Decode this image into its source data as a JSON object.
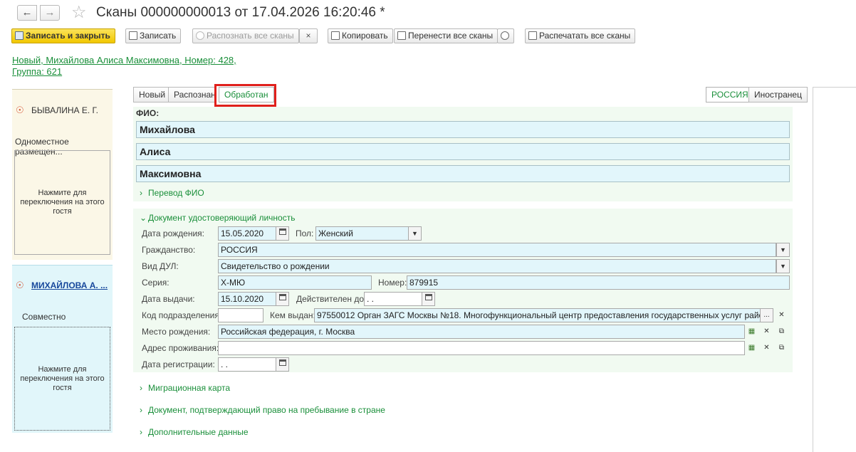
{
  "window": {
    "title": "Сканы 000000000013 от 17.04.2026 16:20:46 *"
  },
  "toolbar": {
    "save_close": "Записать и закрыть",
    "save": "Записать",
    "recognize_all": "Распознать все сканы",
    "close_x": "×",
    "copy": "Копировать",
    "move_all": "Перенести все сканы",
    "print_all": "Распечатать все сканы"
  },
  "header": {
    "link_line1": "Новый, Михайлова Алиса Максимовна, Номер: 428,",
    "link_line2": "Группа: 621"
  },
  "guests": [
    {
      "name": "БЫВАЛИНА Е. Г.",
      "placement": "Одноместное размещен...",
      "hint": "Нажмите для переключения на этого гостя"
    },
    {
      "name": "МИХАЙЛОВА А. ...",
      "placement": "Совместно",
      "hint": "Нажмите для переключения на этого гостя"
    }
  ],
  "status_tabs": [
    "Новый",
    "Распознан",
    "Обработан"
  ],
  "active_status": "Обработан",
  "country_tabs": [
    "РОССИЯ",
    "Иностранец"
  ],
  "fio": {
    "label": "ФИО:",
    "last_name": "Михайлова",
    "first_name": "Алиса",
    "middle_name": "Максимовна",
    "translation_label": "Перевод ФИО"
  },
  "document": {
    "section_label": "Документ удостоверяющий личность",
    "birth_date_label": "Дата рождения:",
    "birth_date": "15.05.2020",
    "sex_label": "Пол:",
    "sex": "Женский",
    "citizenship_label": "Гражданство:",
    "citizenship": "РОССИЯ",
    "doc_type_label": "Вид ДУЛ:",
    "doc_type": "Свидетельство о рождении",
    "series_label": "Серия:",
    "series": "Х-МЮ",
    "number_label": "Номер:",
    "number": "879915",
    "issue_date_label": "Дата выдачи:",
    "issue_date": "15.10.2020",
    "valid_until_label": "Действителен до:",
    "valid_until": " .  .",
    "dept_code_label": "Код подразделения:",
    "dept_code": "",
    "issued_by_label": "Кем выдан:",
    "issued_by": "97550012 Орган ЗАГС Москвы №18. Многофункциональный центр предоставления государственных услуг района Сокольники",
    "birth_place_label": "Место рождения:",
    "birth_place": "Российская федерация, г. Москва",
    "address_label": "Адрес проживания:",
    "address": "",
    "registration_date_label": "Дата регистрации:",
    "registration_date": " .  ."
  },
  "collapsed_sections": [
    "Миграционная карта",
    "Документ, подтверждающий право на пребывание в стране",
    "Дополнительные данные"
  ]
}
